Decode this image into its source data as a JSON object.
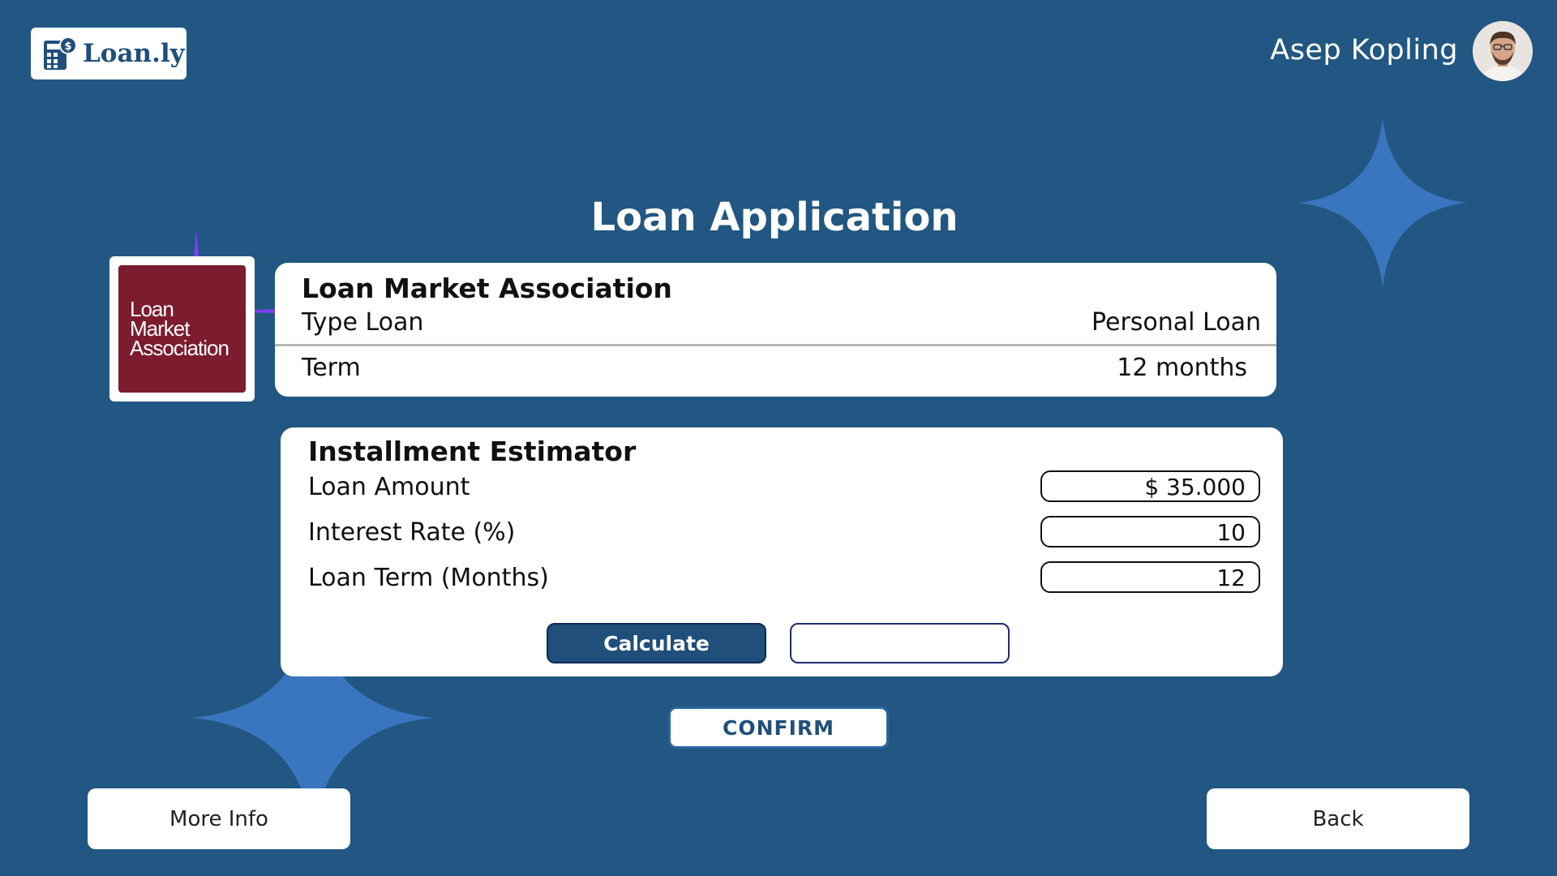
{
  "app": {
    "brand_name": "Loan.ly",
    "page_title": "Loan Application"
  },
  "user": {
    "name": "Asep Kopling"
  },
  "lender": {
    "logo_lines": [
      "Loan",
      "Market",
      "Association"
    ],
    "name": "Loan Market Association",
    "type_label": "Type Loan",
    "type_value": "Personal Loan",
    "term_label": "Term",
    "term_value": "12 months"
  },
  "estimator": {
    "title": "Installment Estimator",
    "fields": [
      {
        "label": "Loan Amount",
        "value": "$ 35.000"
      },
      {
        "label": "Interest Rate (%)",
        "value": "10"
      },
      {
        "label": "Loan Term (Months)",
        "value": "12"
      }
    ],
    "calculate_label": "Calculate",
    "result_value": ""
  },
  "actions": {
    "confirm_label": "CONFIRM",
    "more_info_label": "More Info",
    "back_label": "Back"
  },
  "colors": {
    "background": "#215782",
    "primary": "#1f4f7a",
    "star": "#3a75bf",
    "lender_brand": "#7d1b2f"
  },
  "icons": {
    "brand": "calculator-dollar-icon",
    "decoration": "sparkle-star-icon"
  }
}
